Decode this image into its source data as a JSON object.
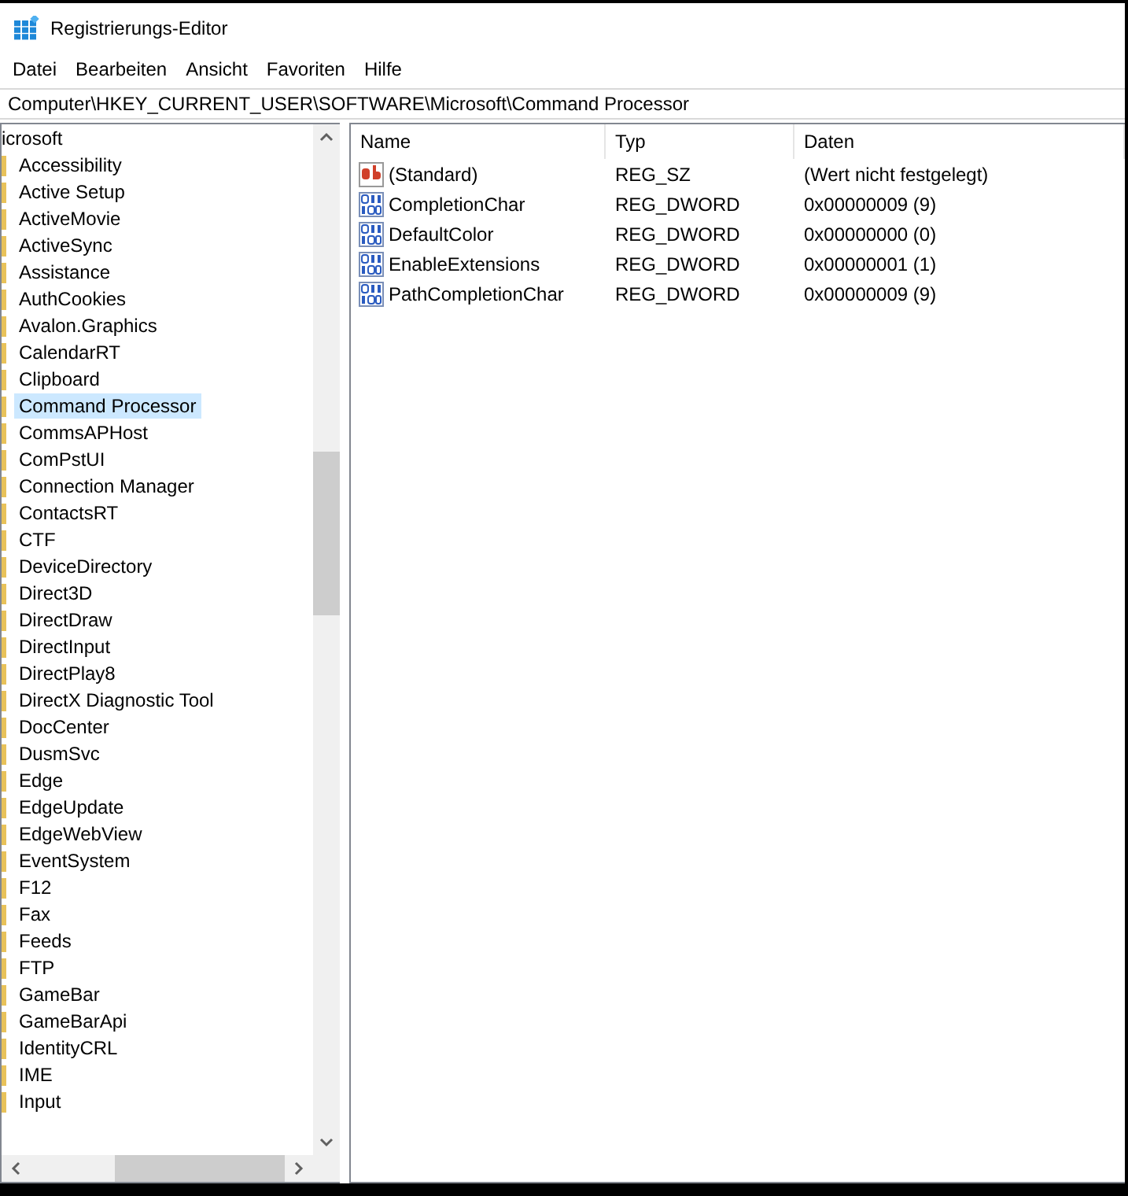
{
  "window": {
    "title": "Registrierungs-Editor"
  },
  "menu": [
    "Datei",
    "Bearbeiten",
    "Ansicht",
    "Favoriten",
    "Hilfe"
  ],
  "address": "Computer\\HKEY_CURRENT_USER\\SOFTWARE\\Microsoft\\Command Processor",
  "tree": {
    "parent": "icrosoft",
    "items": [
      {
        "label": "Accessibility",
        "selected": false
      },
      {
        "label": "Active Setup",
        "selected": false
      },
      {
        "label": "ActiveMovie",
        "selected": false
      },
      {
        "label": "ActiveSync",
        "selected": false
      },
      {
        "label": "Assistance",
        "selected": false
      },
      {
        "label": "AuthCookies",
        "selected": false
      },
      {
        "label": "Avalon.Graphics",
        "selected": false
      },
      {
        "label": "CalendarRT",
        "selected": false
      },
      {
        "label": "Clipboard",
        "selected": false
      },
      {
        "label": "Command Processor",
        "selected": true
      },
      {
        "label": "CommsAPHost",
        "selected": false
      },
      {
        "label": "ComPstUI",
        "selected": false
      },
      {
        "label": "Connection Manager",
        "selected": false
      },
      {
        "label": "ContactsRT",
        "selected": false
      },
      {
        "label": "CTF",
        "selected": false
      },
      {
        "label": "DeviceDirectory",
        "selected": false
      },
      {
        "label": "Direct3D",
        "selected": false
      },
      {
        "label": "DirectDraw",
        "selected": false
      },
      {
        "label": "DirectInput",
        "selected": false
      },
      {
        "label": "DirectPlay8",
        "selected": false
      },
      {
        "label": "DirectX Diagnostic Tool",
        "selected": false
      },
      {
        "label": "DocCenter",
        "selected": false
      },
      {
        "label": "DusmSvc",
        "selected": false
      },
      {
        "label": "Edge",
        "selected": false
      },
      {
        "label": "EdgeUpdate",
        "selected": false
      },
      {
        "label": "EdgeWebView",
        "selected": false
      },
      {
        "label": "EventSystem",
        "selected": false
      },
      {
        "label": "F12",
        "selected": false
      },
      {
        "label": "Fax",
        "selected": false
      },
      {
        "label": "Feeds",
        "selected": false
      },
      {
        "label": "FTP",
        "selected": false
      },
      {
        "label": "GameBar",
        "selected": false
      },
      {
        "label": "GameBarApi",
        "selected": false
      },
      {
        "label": "IdentityCRL",
        "selected": false
      },
      {
        "label": "IME",
        "selected": false
      },
      {
        "label": "Input",
        "selected": false
      }
    ]
  },
  "table": {
    "columns": [
      "Name",
      "Typ",
      "Daten"
    ],
    "rows": [
      {
        "kind": "string",
        "name": "(Standard)",
        "type": "REG_SZ",
        "data": "(Wert nicht festgelegt)"
      },
      {
        "kind": "dword",
        "name": "CompletionChar",
        "type": "REG_DWORD",
        "data": "0x00000009 (9)"
      },
      {
        "kind": "dword",
        "name": "DefaultColor",
        "type": "REG_DWORD",
        "data": "0x00000000 (0)"
      },
      {
        "kind": "dword",
        "name": "EnableExtensions",
        "type": "REG_DWORD",
        "data": "0x00000001 (1)"
      },
      {
        "kind": "dword",
        "name": "PathCompletionChar",
        "type": "REG_DWORD",
        "data": "0x00000009 (9)"
      }
    ]
  }
}
